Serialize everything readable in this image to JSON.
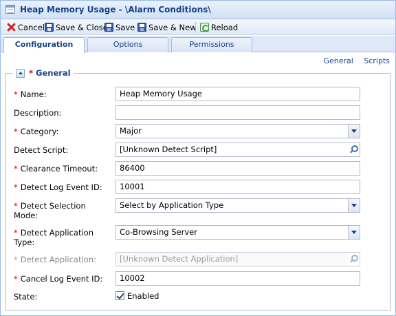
{
  "window": {
    "title": "Heap Memory Usage - \\Alarm Conditions\\"
  },
  "toolbar": {
    "cancel": "Cancel",
    "save_close": "Save & Close",
    "save": "Save",
    "save_new": "Save & New",
    "reload": "Reload"
  },
  "tabs": [
    "Configuration",
    "Options",
    "Permissions"
  ],
  "links": {
    "general": "General",
    "scripts": "Scripts"
  },
  "section": {
    "title": "General",
    "required_mark": "*"
  },
  "form": {
    "name": {
      "label": "Name:",
      "value": "Heap Memory Usage"
    },
    "description": {
      "label": "Description:",
      "value": ""
    },
    "category": {
      "label": "Category:",
      "value": "Major"
    },
    "detect_script": {
      "label": "Detect Script:",
      "value": "[Unknown Detect Script]"
    },
    "clearance_timeout": {
      "label": "Clearance Timeout:",
      "value": "86400"
    },
    "detect_log_event_id": {
      "label": "Detect Log Event ID:",
      "value": "10001"
    },
    "detect_selection_mode": {
      "label_line1": "Detect Selection",
      "label_line2": "Mode:",
      "value": "Select by Application Type"
    },
    "detect_application_type": {
      "label_line1": "Detect Application",
      "label_line2": "Type:",
      "value": "Co-Browsing Server"
    },
    "detect_application": {
      "label": "Detect Application:",
      "value": "[Unknown Detect Application]"
    },
    "cancel_log_event_id": {
      "label": "Cancel Log Event ID:",
      "value": "10002"
    },
    "state": {
      "label": "State:",
      "checkbox_label": "Enabled",
      "checked": true
    }
  }
}
